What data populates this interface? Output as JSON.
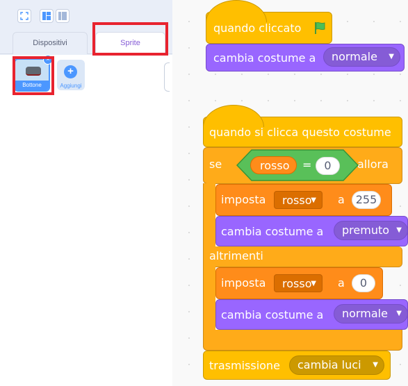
{
  "left_panel": {
    "tabs": [
      {
        "label": "Dispositivi",
        "active": false
      },
      {
        "label": "Sprite",
        "active": true
      }
    ],
    "sprites": [
      {
        "label": "Bottone",
        "selected": true
      }
    ],
    "add_sprite_label": "Aggiungi"
  },
  "scripts": [
    {
      "hat": {
        "label": "quando cliccato",
        "icon": "green-flag-icon"
      },
      "blocks": [
        {
          "label": "cambia costume a",
          "dropdown": "normale"
        }
      ]
    },
    {
      "hat": {
        "label": "quando si clicca questo costume"
      },
      "if_else": {
        "if_label": "se",
        "condition": {
          "variable": "rosso",
          "operator": "=",
          "value": "0"
        },
        "then_label": "allora",
        "then_blocks": [
          {
            "label": "imposta",
            "variable": "rosso",
            "to_label": "a",
            "value": "255"
          },
          {
            "label": "cambia costume a",
            "dropdown": "premuto"
          }
        ],
        "else_label": "altrimenti",
        "else_blocks": [
          {
            "label": "imposta",
            "variable": "rosso",
            "to_label": "a",
            "value": "0"
          },
          {
            "label": "cambia costume a",
            "dropdown": "normale"
          }
        ]
      },
      "after": {
        "label": "trasmissione",
        "dropdown": "cambia luci"
      }
    }
  ],
  "colors": {
    "events": "#ffbf00",
    "looks": "#9966ff",
    "control": "#ffab19",
    "variables": "#ff8c1a",
    "operators": "#59c059",
    "highlight": "#e8232f"
  }
}
